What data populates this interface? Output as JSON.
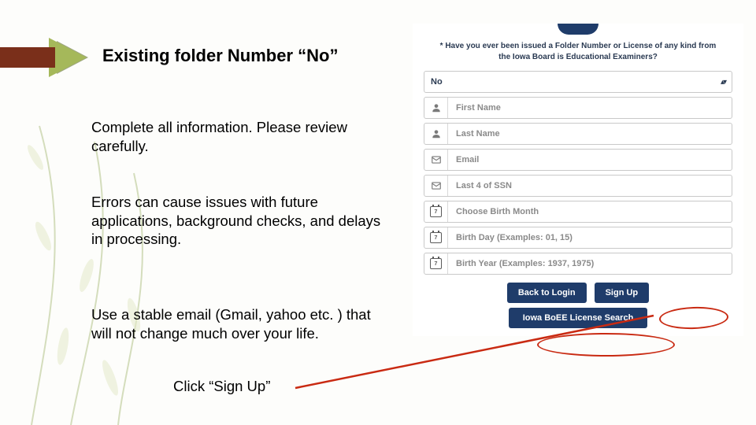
{
  "heading": "Existing folder Number “No”",
  "paragraphs": {
    "p1": "Complete all information. Please review carefully.",
    "p2": "Errors can cause issues with future applications, background checks, and delays in processing.",
    "p3": "Use a stable email (Gmail, yahoo etc. ) that will not change much over your life.",
    "p4": "Click “Sign Up”"
  },
  "form": {
    "question": "* Have you ever been issued a Folder Number or License of any kind from the Iowa Board is Educational Examiners?",
    "select_value": "No",
    "fields": {
      "first_name": "First Name",
      "last_name": "Last Name",
      "email": "Email",
      "ssn": "Last 4 of SSN",
      "month": "Choose Birth Month",
      "day": "Birth Day (Examples: 01, 15)",
      "year": "Birth Year (Examples: 1937, 1975)"
    },
    "buttons": {
      "back": "Back to Login",
      "signup": "Sign Up",
      "search": "Iowa BoEE License Search"
    },
    "cal_num": "7"
  }
}
